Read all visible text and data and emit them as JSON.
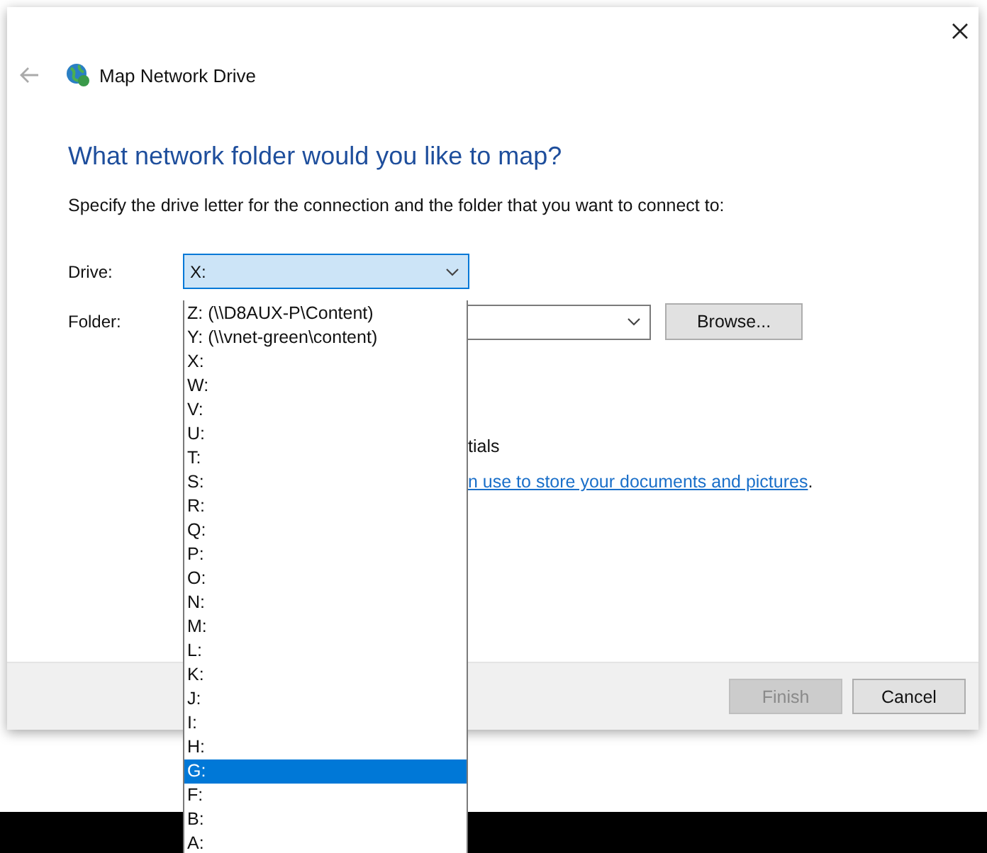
{
  "window": {
    "title": "Map Network Drive"
  },
  "heading": "What network folder would you like to map?",
  "instruction": "Specify the drive letter for the connection and the folder that you want to connect to:",
  "drive": {
    "label": "Drive:",
    "value": "X:",
    "focused": true
  },
  "folder": {
    "label": "Folder:"
  },
  "browse_button": "Browse...",
  "partial_text": "tials",
  "link": {
    "text": "n use to store your documents and pictures",
    "suffix": "."
  },
  "buttons": [
    {
      "label": "Finish",
      "disabled": true
    },
    {
      "label": "Cancel",
      "disabled": false
    }
  ],
  "dropdown": {
    "items": [
      {
        "label": "Z: (\\\\D8AUX-P\\Content)",
        "selected": false
      },
      {
        "label": "Y: (\\\\vnet-green\\content)",
        "selected": false
      },
      {
        "label": "X:",
        "selected": false
      },
      {
        "label": "W:",
        "selected": false
      },
      {
        "label": "V:",
        "selected": false
      },
      {
        "label": "U:",
        "selected": false
      },
      {
        "label": "T:",
        "selected": false
      },
      {
        "label": "S:",
        "selected": false
      },
      {
        "label": "R:",
        "selected": false
      },
      {
        "label": "Q:",
        "selected": false
      },
      {
        "label": "P:",
        "selected": false
      },
      {
        "label": "O:",
        "selected": false
      },
      {
        "label": "N:",
        "selected": false
      },
      {
        "label": "M:",
        "selected": false
      },
      {
        "label": "L:",
        "selected": false
      },
      {
        "label": "K:",
        "selected": false
      },
      {
        "label": "J:",
        "selected": false
      },
      {
        "label": "I:",
        "selected": false
      },
      {
        "label": "H:",
        "selected": false
      },
      {
        "label": "G:",
        "selected": true
      },
      {
        "label": "F:",
        "selected": false
      },
      {
        "label": "B:",
        "selected": false
      },
      {
        "label": "A:",
        "selected": false
      }
    ]
  }
}
